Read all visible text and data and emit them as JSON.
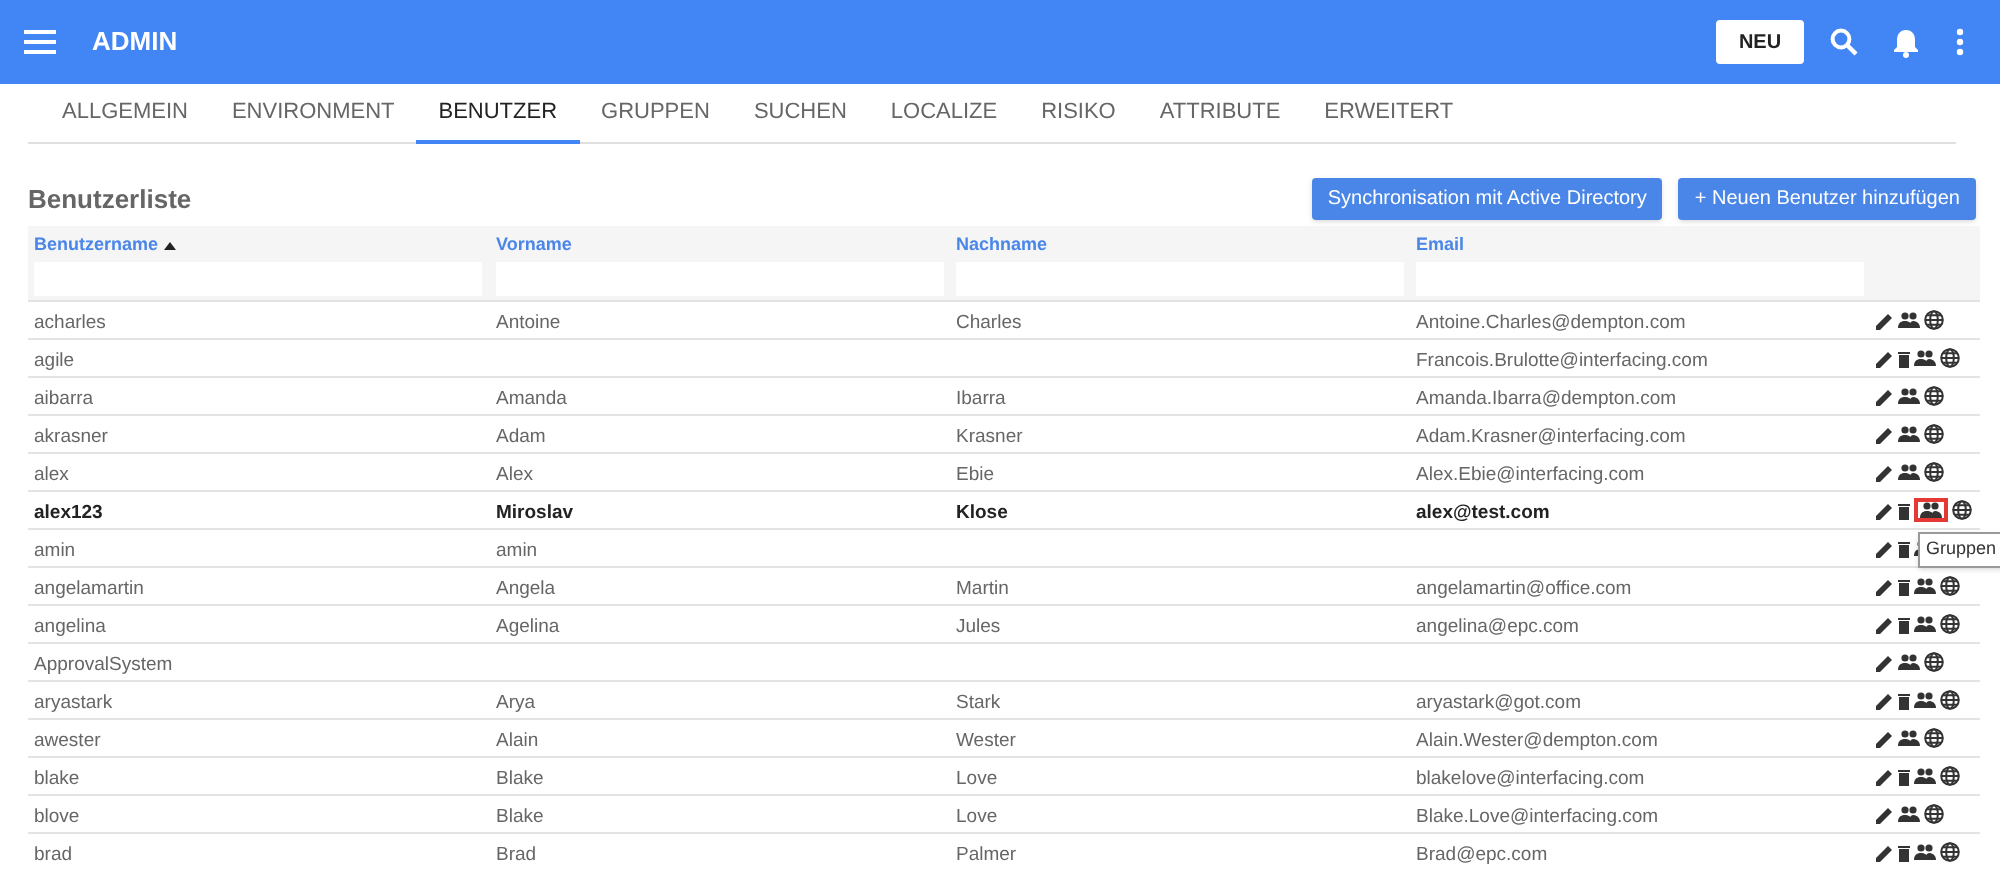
{
  "app_bar": {
    "title": "ADMIN",
    "new_button": "NEU"
  },
  "tabs": [
    {
      "label": "ALLGEMEIN",
      "selected": false
    },
    {
      "label": "ENVIRONMENT",
      "selected": false
    },
    {
      "label": "BENUTZER",
      "selected": true
    },
    {
      "label": "GRUPPEN",
      "selected": false
    },
    {
      "label": "SUCHEN",
      "selected": false
    },
    {
      "label": "LOCALIZE",
      "selected": false
    },
    {
      "label": "RISIKO",
      "selected": false
    },
    {
      "label": "ATTRIBUTE",
      "selected": false
    },
    {
      "label": "ERWEITERT",
      "selected": false
    }
  ],
  "section_title": "Benutzerliste",
  "buttons": [
    "Synchronisation mit Active Directory",
    "+ Neuen Benutzer hinzufügen"
  ],
  "table": {
    "columns": [
      {
        "label": "Benutzername",
        "sorted_ascending": true
      },
      {
        "label": "Vorname",
        "sorted_ascending": false
      },
      {
        "label": "Nachname",
        "sorted_ascending": false
      },
      {
        "label": "Email",
        "sorted_ascending": false
      }
    ],
    "rows": [
      {
        "cells": [
          "acharles",
          "Antoine",
          "Charles",
          "Antoine.Charles@dempton.com"
        ],
        "deletable": false,
        "selected": false
      },
      {
        "cells": [
          "agile",
          "",
          "",
          "Francois.Brulotte@interfacing.com"
        ],
        "deletable": true,
        "selected": false
      },
      {
        "cells": [
          "aibarra",
          "Amanda",
          "Ibarra",
          "Amanda.Ibarra@dempton.com"
        ],
        "deletable": false,
        "selected": false
      },
      {
        "cells": [
          "akrasner",
          "Adam",
          "Krasner",
          "Adam.Krasner@interfacing.com"
        ],
        "deletable": false,
        "selected": false
      },
      {
        "cells": [
          "alex",
          "Alex",
          "Ebie",
          "Alex.Ebie@interfacing.com"
        ],
        "deletable": false,
        "selected": false
      },
      {
        "cells": [
          "alex123",
          "Miroslav",
          "Klose",
          "alex@test.com"
        ],
        "deletable": true,
        "selected": true,
        "tooltip": "Gruppen"
      },
      {
        "cells": [
          "amin",
          "amin",
          "",
          ""
        ],
        "deletable": true,
        "selected": false
      },
      {
        "cells": [
          "angelamartin",
          "Angela",
          "Martin",
          "angelamartin@office.com"
        ],
        "deletable": true,
        "selected": false
      },
      {
        "cells": [
          "angelina",
          "Agelina",
          "Jules",
          "angelina@epc.com"
        ],
        "deletable": true,
        "selected": false
      },
      {
        "cells": [
          "ApprovalSystem",
          "",
          "",
          ""
        ],
        "deletable": false,
        "selected": false
      },
      {
        "cells": [
          "aryastark",
          "Arya",
          "Stark",
          "aryastark@got.com"
        ],
        "deletable": true,
        "selected": false
      },
      {
        "cells": [
          "awester",
          "Alain",
          "Wester",
          "Alain.Wester@dempton.com"
        ],
        "deletable": false,
        "selected": false
      },
      {
        "cells": [
          "blake",
          "Blake",
          "Love",
          "blakelove@interfacing.com"
        ],
        "deletable": true,
        "selected": false
      },
      {
        "cells": [
          "blove",
          "Blake",
          "Love",
          "Blake.Love@interfacing.com"
        ],
        "deletable": false,
        "selected": false
      },
      {
        "cells": [
          "brad",
          "Brad",
          "Palmer",
          "Brad@epc.com"
        ],
        "deletable": true,
        "selected": false
      }
    ]
  }
}
